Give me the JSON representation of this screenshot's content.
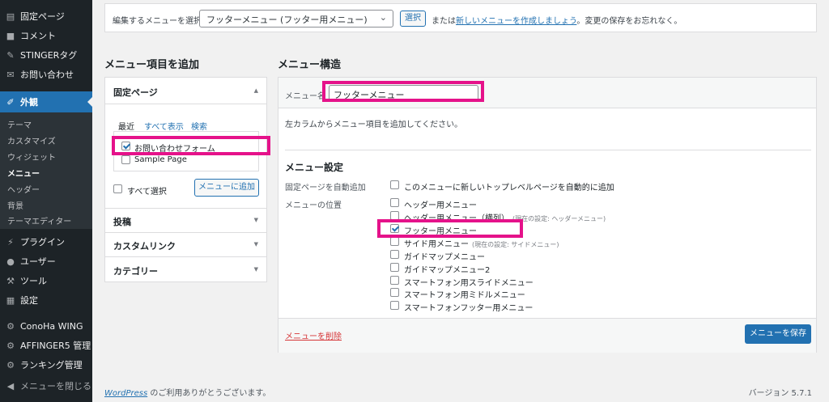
{
  "sidebar": {
    "items": [
      {
        "label": "固定ページ",
        "icon": "pages-icon"
      },
      {
        "label": "コメント",
        "icon": "comments-icon"
      },
      {
        "label": "STINGERタグ",
        "icon": "pin-icon"
      },
      {
        "label": "お問い合わせ",
        "icon": "mail-icon"
      },
      {
        "label": "外観",
        "icon": "brush-icon"
      },
      {
        "label": "プラグイン",
        "icon": "plugin-icon"
      },
      {
        "label": "ユーザー",
        "icon": "user-icon"
      },
      {
        "label": "ツール",
        "icon": "wrench-icon"
      },
      {
        "label": "設定",
        "icon": "settings-icon"
      },
      {
        "label": "ConoHa WING",
        "icon": "gear-icon"
      },
      {
        "label": "AFFINGER5 管理",
        "icon": "gear-icon"
      },
      {
        "label": "ランキング管理",
        "icon": "gear-icon"
      },
      {
        "label": "メニューを閉じる",
        "icon": "collapse-icon"
      }
    ],
    "submenu": [
      "テーマ",
      "カスタマイズ",
      "ウィジェット",
      "メニュー",
      "ヘッダー",
      "背景",
      "テーマエディター"
    ]
  },
  "select_bar": {
    "label": "編集するメニューを選択:",
    "selected": "フッターメニュー (フッター用メニュー)",
    "button": "選択",
    "or_text": "または",
    "new_link": "新しいメニューを作成しましょう",
    "suffix": "。変更の保存をお忘れなく。"
  },
  "add_items": {
    "heading": "メニュー項目を追加",
    "pages_title": "固定ページ",
    "tabs": [
      "最近",
      "すべて表示",
      "検索"
    ],
    "pages": [
      {
        "label": "お問い合わせフォーム",
        "checked": true
      },
      {
        "label": "Sample Page",
        "checked": false
      }
    ],
    "select_all": "すべて選択",
    "add_button": "メニューに追加",
    "sections": [
      "投稿",
      "カスタムリンク",
      "カテゴリー"
    ]
  },
  "structure": {
    "heading": "メニュー構造",
    "name_label": "メニュー名",
    "name_value": "フッターメニュー",
    "instructions": "左カラムからメニュー項目を追加してください。",
    "settings_heading": "メニュー設定",
    "auto_add_label": "固定ページを自動追加",
    "auto_add_option": "このメニューに新しいトップレベルページを自動的に追加",
    "location_label": "メニューの位置",
    "locations": [
      {
        "label": "ヘッダー用メニュー",
        "checked": false,
        "note": ""
      },
      {
        "label": "ヘッダー用メニュー（横列）",
        "checked": false,
        "note": "(現在の設定: ヘッダーメニュー)"
      },
      {
        "label": "フッター用メニュー",
        "checked": true,
        "note": ""
      },
      {
        "label": "サイド用メニュー",
        "checked": false,
        "note": "(現在の設定: サイドメニュー)"
      },
      {
        "label": "ガイドマップメニュー",
        "checked": false,
        "note": ""
      },
      {
        "label": "ガイドマップメニュー2",
        "checked": false,
        "note": ""
      },
      {
        "label": "スマートフォン用スライドメニュー",
        "checked": false,
        "note": ""
      },
      {
        "label": "スマートフォン用ミドルメニュー",
        "checked": false,
        "note": ""
      },
      {
        "label": "スマートフォンフッター用メニュー",
        "checked": false,
        "note": ""
      }
    ],
    "delete_link": "メニューを削除",
    "save_button": "メニューを保存"
  },
  "footer": {
    "wordpress": "WordPress",
    "thanks": " のご利用ありがとうございます。",
    "version": "バージョン 5.7.1"
  },
  "colors": {
    "accent": "#2271b1",
    "highlight": "#e5128a",
    "sidebar": "#1d2327"
  }
}
